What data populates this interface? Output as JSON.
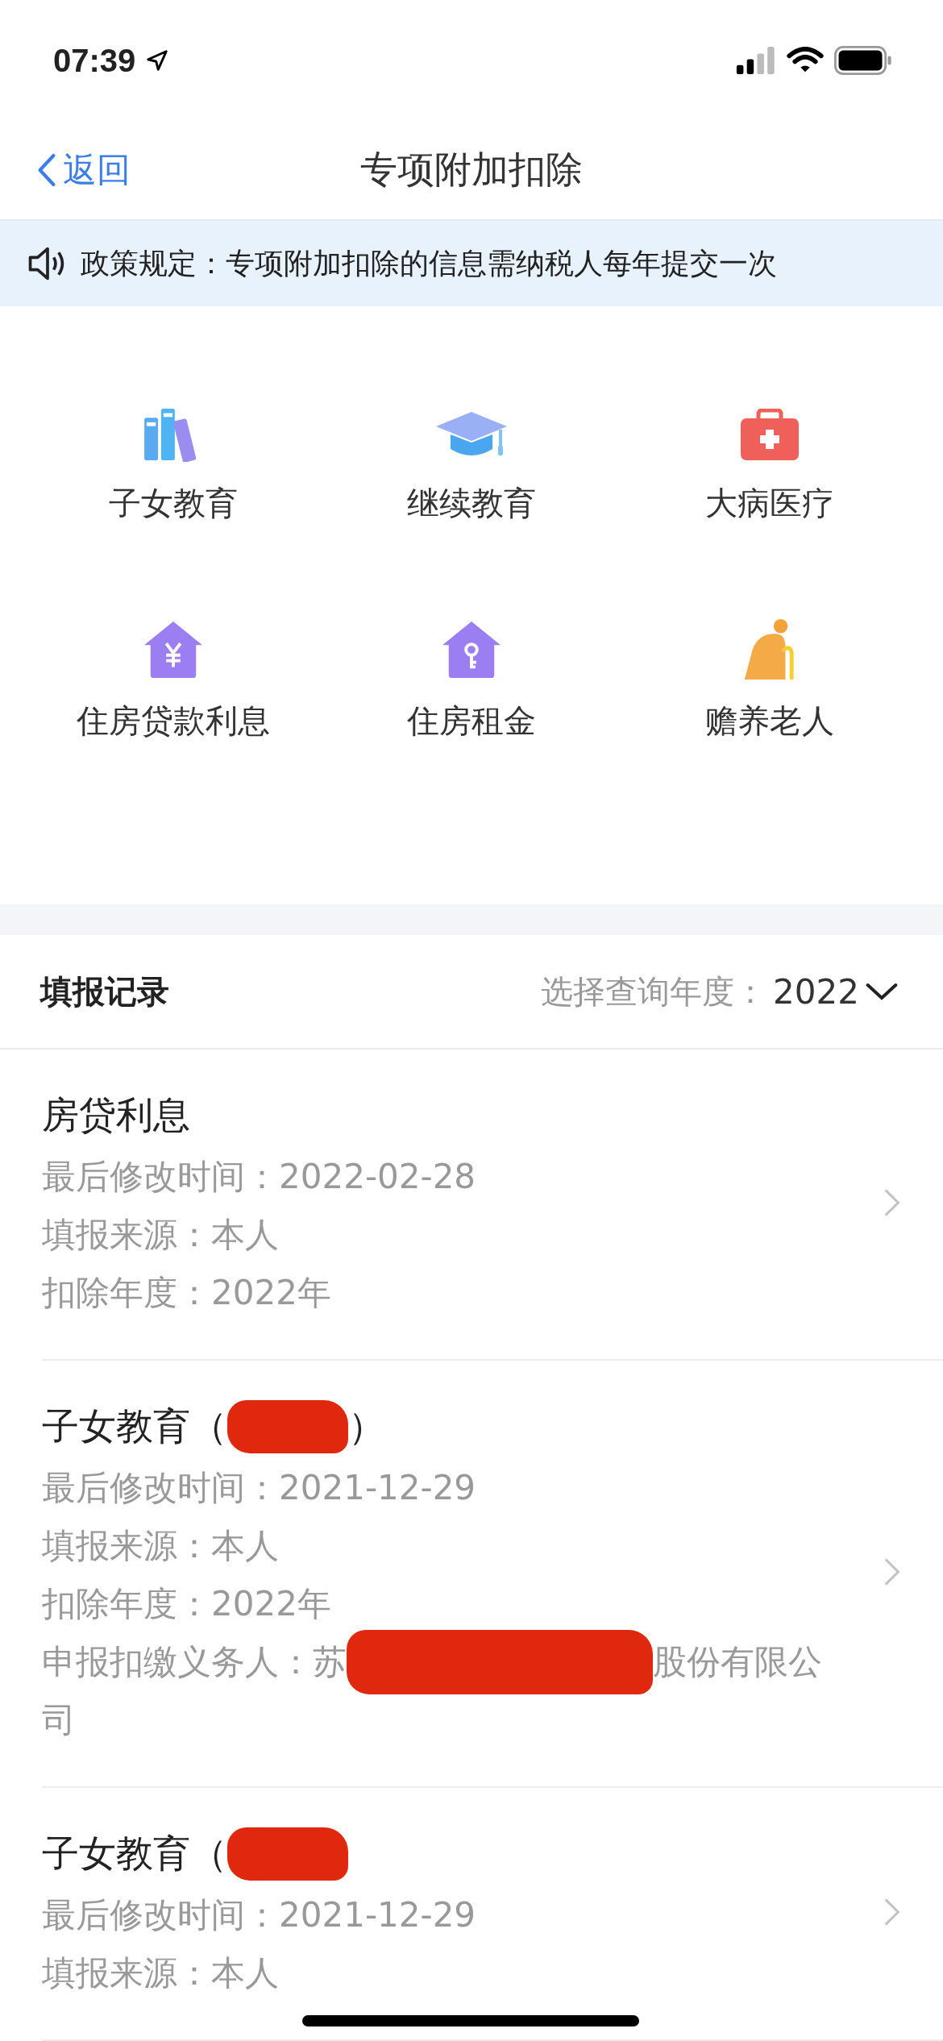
{
  "status_bar": {
    "time": "07:39"
  },
  "nav": {
    "back": "返回",
    "title": "专项附加扣除"
  },
  "notice": {
    "text": "政策规定：专项附加扣除的信息需纳税人每年提交一次"
  },
  "categories": [
    {
      "kind": "books",
      "label": "子女教育"
    },
    {
      "kind": "cap",
      "label": "继续教育"
    },
    {
      "kind": "medkit",
      "label": "大病医疗"
    },
    {
      "kind": "house-yuan",
      "label": "住房贷款利息"
    },
    {
      "kind": "house-key",
      "label": "住房租金"
    },
    {
      "kind": "elder",
      "label": "赡养老人"
    }
  ],
  "records_header": {
    "title": "填报记录",
    "year_label": "选择查询年度：",
    "year": "2022"
  },
  "records": [
    {
      "title": [
        {
          "kind": "text",
          "text": "房贷利息"
        }
      ],
      "lines": [
        [
          {
            "kind": "text",
            "text": "最后修改时间：2022-02-28"
          }
        ],
        [
          {
            "kind": "text",
            "text": "填报来源：本人"
          }
        ],
        [
          {
            "kind": "text",
            "text": "扣除年度：2022年"
          }
        ]
      ]
    },
    {
      "title": [
        {
          "kind": "text",
          "text": "子女教育（"
        },
        {
          "kind": "redaction"
        },
        {
          "kind": "text",
          "text": "）"
        }
      ],
      "lines": [
        [
          {
            "kind": "text",
            "text": "最后修改时间：2021-12-29"
          }
        ],
        [
          {
            "kind": "text",
            "text": "填报来源：本人"
          }
        ],
        [
          {
            "kind": "text",
            "text": "扣除年度：2022年"
          }
        ],
        [
          {
            "kind": "text",
            "text": "申报扣缴义务人：苏"
          },
          {
            "kind": "redaction"
          },
          {
            "kind": "text",
            "text": "股份有限公"
          }
        ],
        [
          {
            "kind": "text",
            "text": "司"
          }
        ]
      ]
    },
    {
      "title": [
        {
          "kind": "text",
          "text": "子女教育（"
        },
        {
          "kind": "redaction"
        }
      ],
      "lines": [
        [
          {
            "kind": "text",
            "text": "最后修改时间：2021-12-29"
          }
        ],
        [
          {
            "kind": "text",
            "text": "填报来源：本人"
          }
        ]
      ]
    }
  ]
}
